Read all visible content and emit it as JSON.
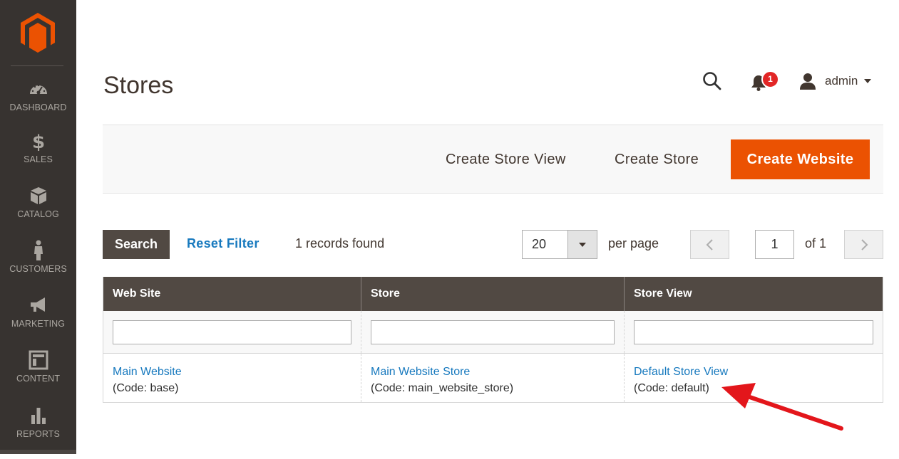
{
  "sidebar": {
    "logo": "magento-logo",
    "items": [
      {
        "label": "DASHBOARD",
        "icon": "dashboard-icon"
      },
      {
        "label": "SALES",
        "icon": "dollar-icon"
      },
      {
        "label": "CATALOG",
        "icon": "box-icon"
      },
      {
        "label": "CUSTOMERS",
        "icon": "person-icon"
      },
      {
        "label": "MARKETING",
        "icon": "megaphone-icon"
      },
      {
        "label": "CONTENT",
        "icon": "layout-icon"
      },
      {
        "label": "REPORTS",
        "icon": "bar-chart-icon"
      }
    ]
  },
  "header": {
    "title": "Stores",
    "notification_count": "1",
    "user_name": "admin"
  },
  "actions": {
    "create_store_view": "Create Store View",
    "create_store": "Create Store",
    "create_website": "Create Website"
  },
  "toolbar": {
    "search_label": "Search",
    "reset_filter_label": "Reset Filter",
    "records_found": "1 records found",
    "per_page_value": "20",
    "per_page_label": "per page",
    "current_page": "1",
    "page_total": "of 1"
  },
  "grid": {
    "columns": [
      "Web Site",
      "Store",
      "Store View"
    ],
    "rows": [
      {
        "website": {
          "name": "Main Website",
          "code": "(Code: base)"
        },
        "store": {
          "name": "Main Website Store",
          "code": "(Code: main_website_store)"
        },
        "store_view": {
          "name": "Default Store View",
          "code": "(Code: default)"
        }
      }
    ]
  },
  "colors": {
    "sidebar_bg": "#373330",
    "accent": "#eb5202",
    "grid_header_bg": "#514943",
    "link": "#1779be",
    "annotation": "#e3161b"
  }
}
